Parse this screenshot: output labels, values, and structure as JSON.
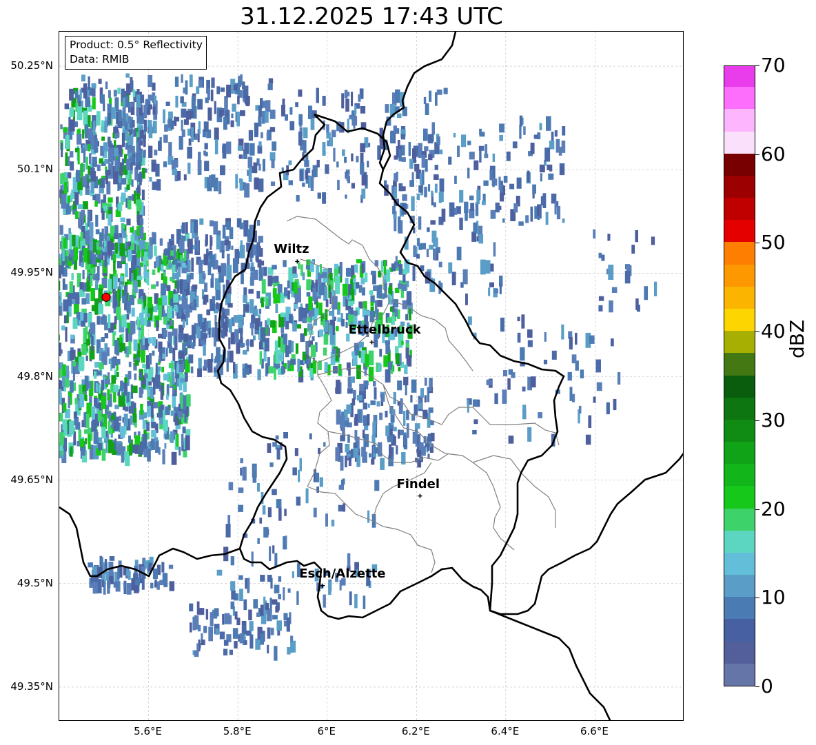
{
  "title": "31.12.2025 17:43 UTC",
  "info": {
    "product": "Product: 0.5° Reflectivity",
    "data": "Data: RMIB"
  },
  "map": {
    "lon_range": [
      5.4,
      6.8
    ],
    "lat_range": [
      49.3,
      50.3
    ],
    "lat_ticks": [
      {
        "value": 50.25,
        "label": "50.25°N"
      },
      {
        "value": 50.1,
        "label": "50.1°N"
      },
      {
        "value": 49.95,
        "label": "49.95°N"
      },
      {
        "value": 49.8,
        "label": "49.8°N"
      },
      {
        "value": 49.65,
        "label": "49.65°N"
      },
      {
        "value": 49.5,
        "label": "49.5°N"
      },
      {
        "value": 49.35,
        "label": "49.35°N"
      }
    ],
    "lon_ticks": [
      {
        "value": 5.6,
        "label": "5.6°E"
      },
      {
        "value": 5.8,
        "label": "5.8°E"
      },
      {
        "value": 6.0,
        "label": "6°E"
      },
      {
        "value": 6.2,
        "label": "6.2°E"
      },
      {
        "value": 6.4,
        "label": "6.4°E"
      },
      {
        "value": 6.6,
        "label": "6.6°E"
      }
    ],
    "cities": [
      {
        "name": "Wiltz",
        "lon": 5.933,
        "lat": 49.967
      },
      {
        "name": "Ettelbruck",
        "lon": 6.1,
        "lat": 49.85
      },
      {
        "name": "Findel",
        "lon": 6.208,
        "lat": 49.627
      },
      {
        "name": "Esch/Alzette",
        "lon": 5.99,
        "lat": 49.497
      }
    ],
    "radar_site": {
      "name": "radar-site",
      "lon": 5.505,
      "lat": 49.915,
      "color": "#ff0000"
    },
    "grid": true
  },
  "colorbar": {
    "label": "dBZ",
    "min": 0,
    "max": 70,
    "ticks": [
      "0",
      "10",
      "20",
      "30",
      "40",
      "50",
      "60",
      "70"
    ],
    "colors": [
      "#6575a8",
      "#535f9b",
      "#4660a2",
      "#4b7bb3",
      "#5a9ec7",
      "#63bfd9",
      "#5cd6c1",
      "#3ed36a",
      "#15c81a",
      "#12b61b",
      "#11a317",
      "#108c15",
      "#0d7611",
      "#0a5d0c",
      "#447812",
      "#a7af02",
      "#fdd500",
      "#fbb500",
      "#fd9800",
      "#fd7e00",
      "#e50000",
      "#c00000",
      "#9d0000",
      "#780000",
      "#fbe0fb",
      "#fdb5fd",
      "#fd6efd",
      "#e93ceb"
    ]
  },
  "colors": {
    "border_country": "#000000",
    "border_canton": "#808080",
    "grid": "#bbbbbb"
  }
}
